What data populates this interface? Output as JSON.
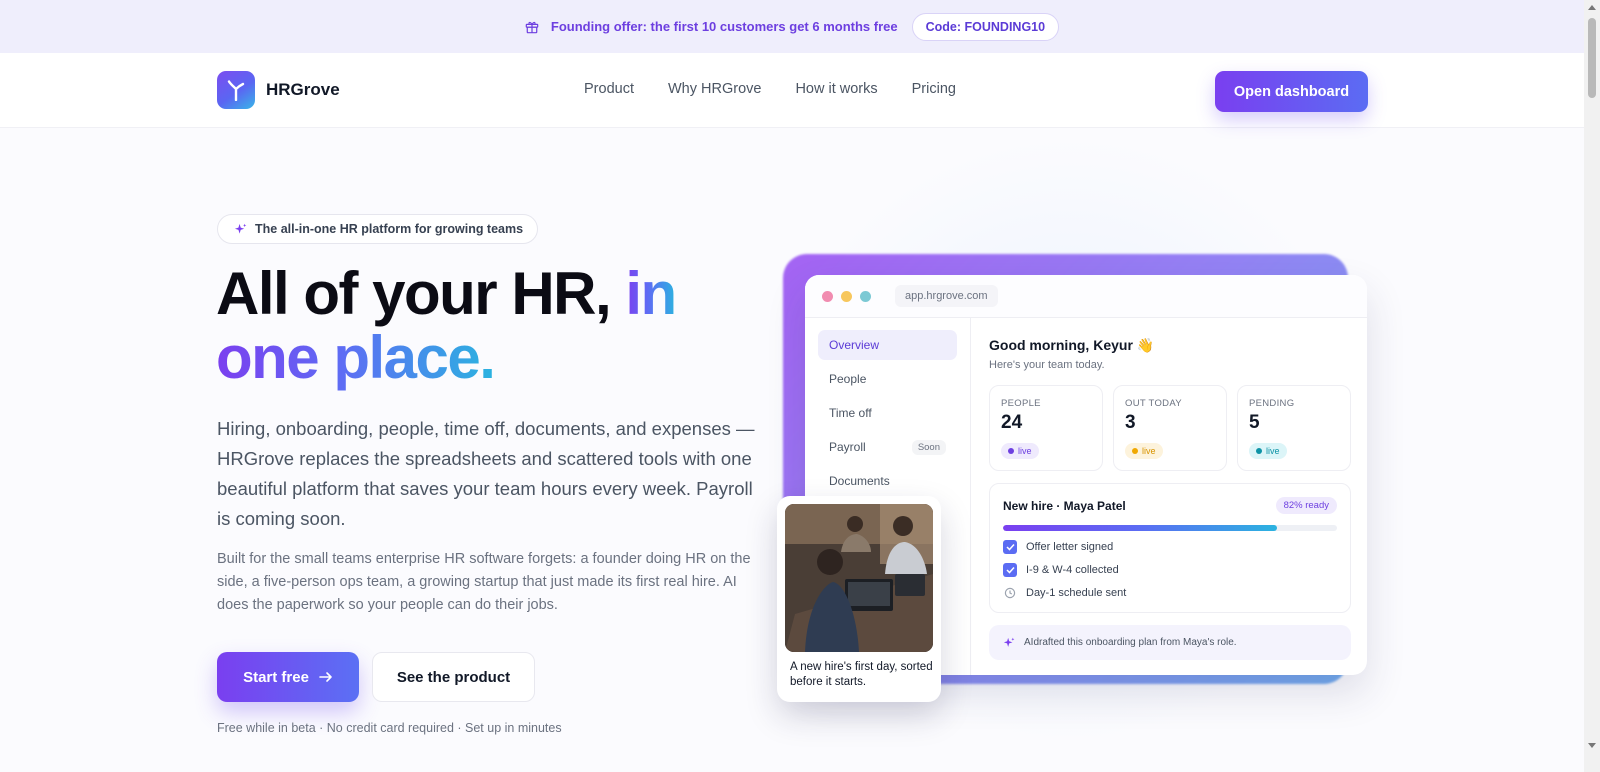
{
  "announcement": {
    "text": "Founding offer: the first 10 customers get 6 months free",
    "code": "Code: FOUNDING10",
    "icon": "gift-icon"
  },
  "nav": {
    "brand": "HRGrove",
    "links": [
      "Product",
      "Why HRGrove",
      "How it works",
      "Pricing"
    ],
    "cta": "Open dashboard"
  },
  "hero": {
    "badge": "The all-in-one HR platform for growing teams",
    "title_plain": "All of your HR, ",
    "title_accent_1": "in",
    "title_accent_2": "one place.",
    "lead": "Hiring, onboarding, people, time off, documents, and expenses — HRGrove replaces the spreadsheets and scattered tools with one beautiful platform that saves your team hours every week. Payroll is coming soon.",
    "sub": "Built for the small teams enterprise HR software forgets: a founder doing HR on the side, a five-person ops team, a growing startup that just made its first real hire. AI does the paperwork so your people can do their jobs.",
    "primary_cta": "Start free",
    "secondary_cta": "See the product",
    "fineprint": "Free while in beta · No credit card required · Set up in minutes"
  },
  "app_preview": {
    "url": "app.hrgrove.com",
    "sidebar": [
      {
        "label": "Overview",
        "active": true,
        "tag": ""
      },
      {
        "label": "People",
        "active": false,
        "tag": ""
      },
      {
        "label": "Time off",
        "active": false,
        "tag": ""
      },
      {
        "label": "Payroll",
        "active": false,
        "tag": "Soon"
      },
      {
        "label": "Documents",
        "active": false,
        "tag": ""
      }
    ],
    "greeting": "Good morning, Keyur 👋",
    "greeting_sub": "Here's your team today.",
    "stats": [
      {
        "label": "PEOPLE",
        "value": "24",
        "badge": "live",
        "color": "#6d3fe0",
        "bg": "#efeafd"
      },
      {
        "label": "OUT TODAY",
        "value": "3",
        "badge": "live",
        "color": "#d89400",
        "bg": "#fdf3dc"
      },
      {
        "label": "PENDING",
        "value": "5",
        "badge": "live",
        "color": "#0e93a6",
        "bg": "#dcf5f8"
      }
    ],
    "new_hire": {
      "title": "New hire · Maya Patel",
      "ready": "82% ready",
      "progress": 0.82,
      "items": [
        {
          "label": "Offer letter signed",
          "done": true
        },
        {
          "label": "I-9 & W-4 collected",
          "done": true
        },
        {
          "label": "Day-1 schedule sent",
          "done": false
        }
      ]
    },
    "ai_note": "AIdrafted this onboarding plan from Maya's role."
  },
  "photo_card": {
    "caption": "A new hire's first day, sorted before it starts."
  },
  "colors": {
    "accent": "#6d3fe0",
    "accent_2": "#5b6cf3",
    "teal": "#2bb3e0"
  }
}
